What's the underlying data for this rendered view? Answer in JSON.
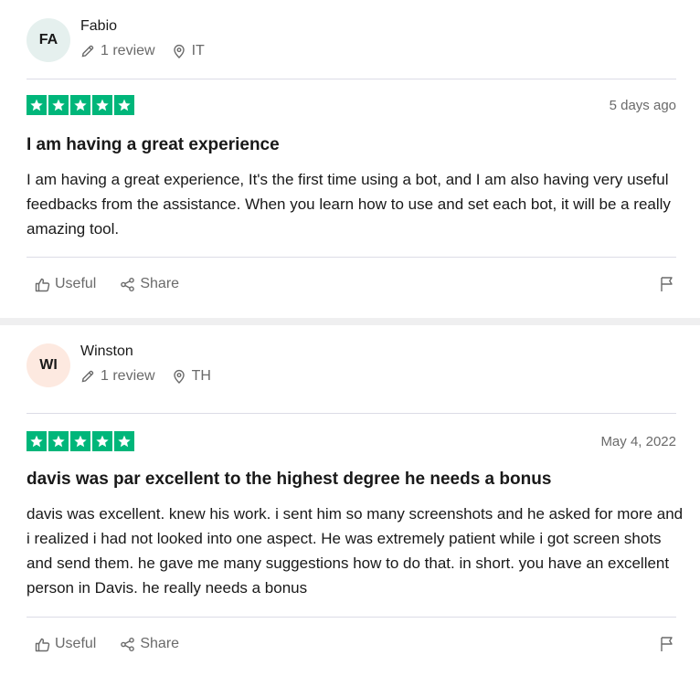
{
  "reviews": [
    {
      "avatar_initials": "FA",
      "name": "Fabio",
      "review_count": "1 review",
      "country": "IT",
      "rating": 5,
      "date": "5 days ago",
      "title": "I am having a great experience",
      "body": "I am having a great experience, It's the first time using a bot, and I am also having very useful feedbacks from the assistance. When you learn how to use and set each bot, it will be a really amazing tool.",
      "useful_label": "Useful",
      "share_label": "Share"
    },
    {
      "avatar_initials": "WI",
      "name": "Winston",
      "review_count": "1 review",
      "country": "TH",
      "rating": 5,
      "date": "May 4, 2022",
      "title": "davis was par excellent to the highest degree he needs a bonus",
      "body": "davis was excellent. knew his work. i sent him so many screenshots and he asked for more and i realized i had not looked into one aspect. He was extremely patient while i got screen shots and send them. he gave me many suggestions how to do that. in short. you have an excellent person in Davis. he really needs a bonus",
      "useful_label": "Useful",
      "share_label": "Share"
    }
  ],
  "colors": {
    "star_green": "#00b67a",
    "muted_text": "#6a6a6a",
    "text": "#191919",
    "avatar_bg_1": "#e5f0ee",
    "avatar_bg_2": "#fde9e0"
  },
  "icons": [
    "pencil-icon",
    "location-pin-icon",
    "star-icon",
    "thumbs-up-icon",
    "share-icon",
    "flag-icon"
  ]
}
